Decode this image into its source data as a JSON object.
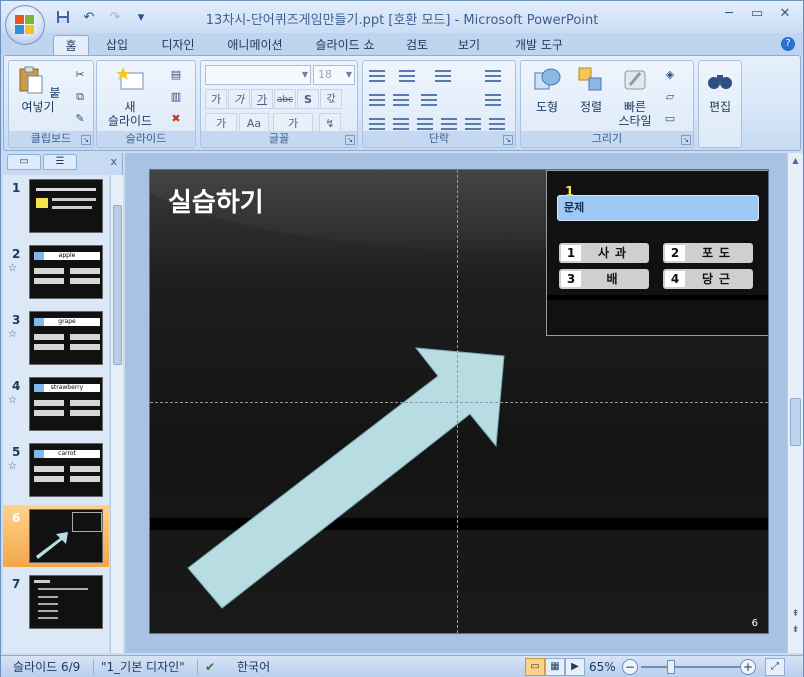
{
  "window": {
    "title": "13차시-단어퀴즈게임만들기.ppt [호환 모드] - Microsoft PowerPoint",
    "controls": [
      "─",
      "▭",
      "✕"
    ]
  },
  "quick_access": {
    "save_icon": "save-icon",
    "undo_icon": "undo-icon",
    "redo_icon": "redo-icon",
    "customize": "▾"
  },
  "tabs": [
    "홈",
    "삽입",
    "디자인",
    "애니메이션",
    "슬라이드 쇼",
    "검토",
    "보기",
    "개발 도구"
  ],
  "active_tab": "홈",
  "ribbon": {
    "clipboard": {
      "label": "클립보드",
      "paste": "붙여넣기"
    },
    "slides": {
      "label": "슬라이드",
      "new_slide_line1": "새",
      "new_slide_line2": "슬라이드"
    },
    "font": {
      "label": "글꼴",
      "font_name": "",
      "font_size": "18"
    },
    "paragraph": {
      "label": "단락"
    },
    "drawing": {
      "label": "그리기",
      "shapes": "도형",
      "arrange": "정렬",
      "quick_styles_line1": "빠른",
      "quick_styles_line2": "스타일"
    },
    "editing": {
      "label": "편집"
    }
  },
  "thumbnails": [
    {
      "num": "1",
      "star": "",
      "word": ""
    },
    {
      "num": "2",
      "star": "☆",
      "word": "apple"
    },
    {
      "num": "3",
      "star": "☆",
      "word": "grape"
    },
    {
      "num": "4",
      "star": "☆",
      "word": "strawberry"
    },
    {
      "num": "5",
      "star": "☆",
      "word": "carrot"
    },
    {
      "num": "6",
      "star": "",
      "word": ""
    },
    {
      "num": "7",
      "star": "",
      "word": ""
    }
  ],
  "selected_slide": "6",
  "slide": {
    "title": "실습하기",
    "number": "6",
    "preview": {
      "question_num": "1",
      "question_label": "문제",
      "answers": [
        {
          "n": "1",
          "text": "사과"
        },
        {
          "n": "2",
          "text": "포도"
        },
        {
          "n": "3",
          "text": "배"
        },
        {
          "n": "4",
          "text": "당근"
        }
      ]
    }
  },
  "status": {
    "slide_info": "슬라이드 6/9",
    "theme": "\"1_기본 디자인\"",
    "language": "한국어",
    "zoom": "65%"
  },
  "colors": {
    "ribbon": "#dfeafa",
    "selected_thumb": "#f3a64a",
    "arrow_fill": "#b7dde3",
    "question_box": "#9ec9f5"
  }
}
